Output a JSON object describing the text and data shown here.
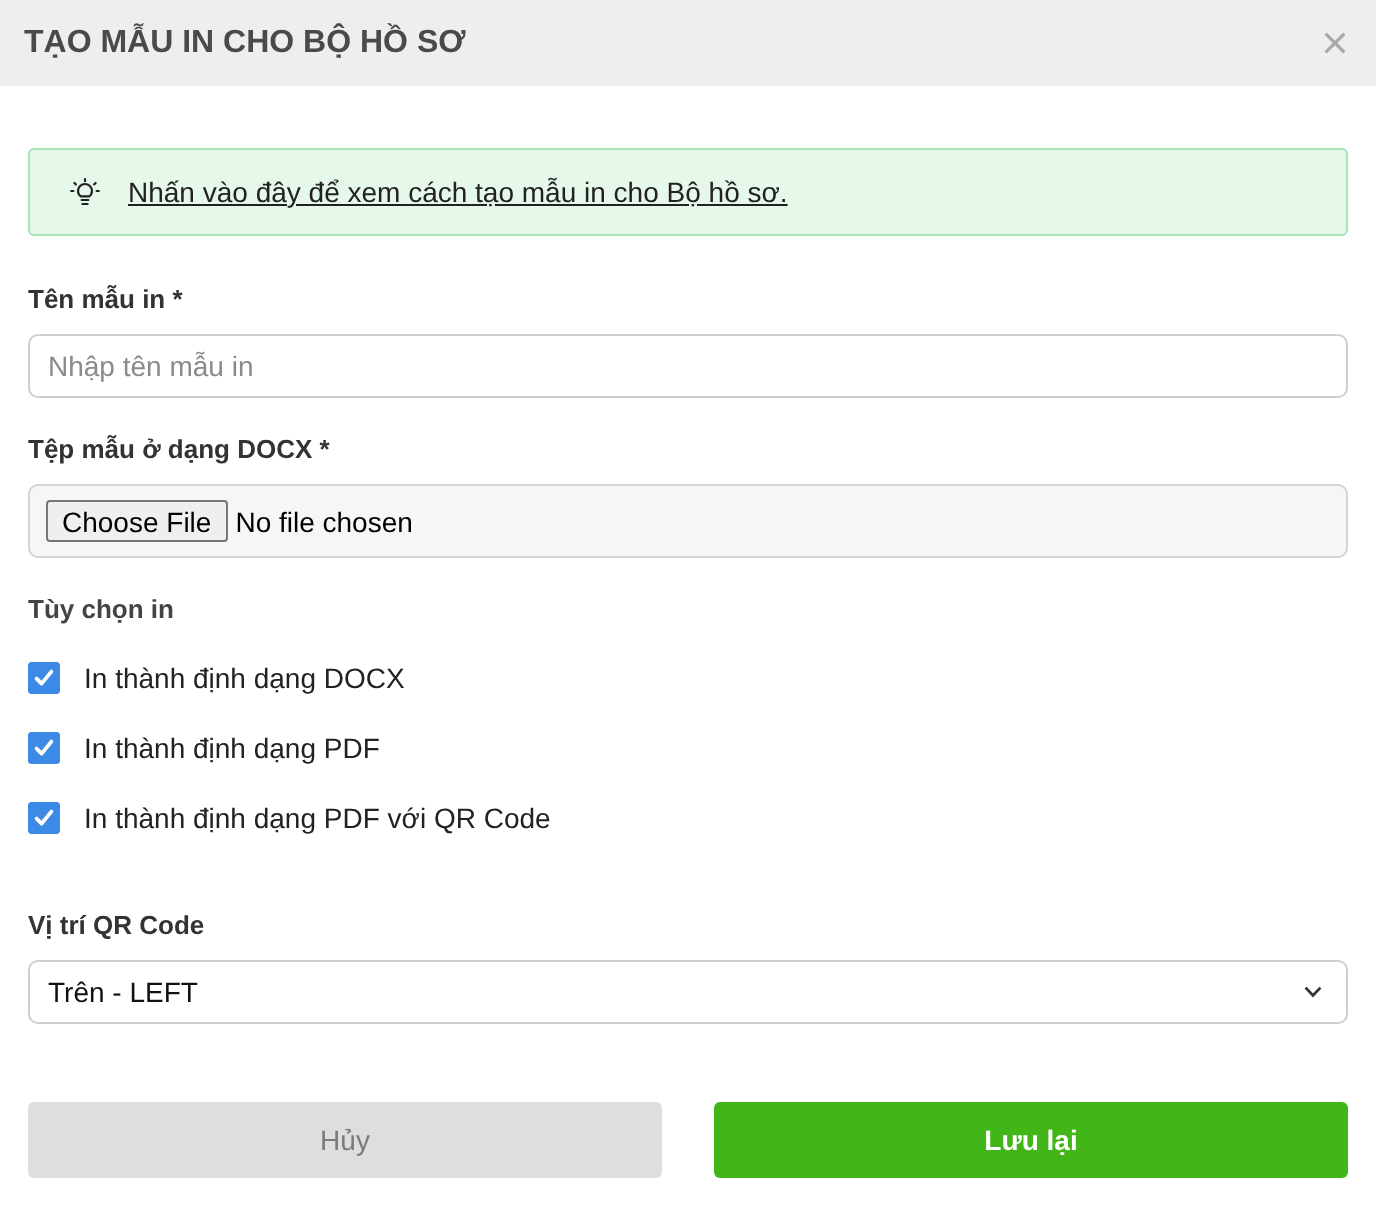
{
  "dialog": {
    "title": "TẠO MẪU IN CHO BỘ HỒ SƠ"
  },
  "hint": {
    "link": "Nhấn vào đây để xem cách tạo mẫu in cho Bộ hồ sơ."
  },
  "name_field": {
    "label": "Tên mẫu in *",
    "placeholder": "Nhập tên mẫu in"
  },
  "file_field": {
    "label": "Tệp mẫu ở dạng DOCX *",
    "button": "Choose File",
    "status": "No file chosen"
  },
  "print_options": {
    "label": "Tùy chọn in",
    "items": [
      {
        "label": "In thành định dạng DOCX",
        "checked": true
      },
      {
        "label": "In thành định dạng PDF",
        "checked": true
      },
      {
        "label": "In thành định dạng PDF với QR Code",
        "checked": true
      }
    ]
  },
  "qr_position": {
    "label": "Vị trí QR Code",
    "value": "Trên - LEFT"
  },
  "buttons": [
    {
      "kind": "cancel",
      "label": "Hủy"
    },
    {
      "kind": "submit",
      "label": "Lưu lại"
    }
  ]
}
